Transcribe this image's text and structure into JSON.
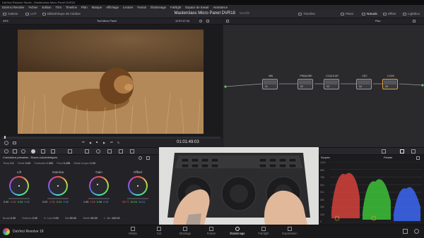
{
  "window": {
    "title": "DaVinci Resolve Studio - Masterclass Micro Panel DVR18"
  },
  "menu": [
    "DaVinci Resolve",
    "Fichier",
    "Edition",
    "Trim",
    "Timeline",
    "Plan",
    "Marque",
    "Affichage",
    "Lecture",
    "Fusion",
    "Étalonnage",
    "Fairlight",
    "Espace de travail",
    "Assistance"
  ],
  "toolbar": {
    "gallery": "Galerie",
    "lut": "LUT",
    "media_library": "Bibliothèque de médias",
    "project_title": "Masterclass Micro Panel DVR18",
    "modified": "Modifié",
    "timeline": "Timeline",
    "clips": "Plans",
    "nodes": "Nœuds",
    "effects": "Effets",
    "lightbox": "Lightbox"
  },
  "viewer": {
    "zoom": "44%",
    "clip_name": "Test Micro Panel",
    "timecode": "12:57:47:15",
    "playhead_timecode": "01:01:49:03"
  },
  "node_editor": {
    "mode": "Plan",
    "nodes": [
      {
        "label": "WB",
        "num": "01"
      },
      {
        "label": "PRIMAIRE",
        "num": "02"
      },
      {
        "label": "COULEUR",
        "num": "03"
      },
      {
        "label": "CEC",
        "num": "04"
      },
      {
        "label": "LOOK",
        "num": "05"
      }
    ]
  },
  "color_panel": {
    "title": "Corrections primaires - Roues colorimétriques",
    "params_top": [
      {
        "label": "Temp",
        "value": "0.0"
      },
      {
        "label": "Teinte",
        "value": "0.00"
      },
      {
        "label": "Contraste",
        "value": "1.000"
      },
      {
        "label": "Pivot",
        "value": "0.435"
      },
      {
        "label": "Détail moyen",
        "value": "0.00"
      }
    ],
    "wheels": [
      {
        "name": "Lift",
        "values": [
          "0.00",
          "-0.01",
          "0.00",
          "0.02"
        ]
      },
      {
        "name": "Gamma",
        "values": [
          "0.00",
          "-0.01",
          "0.01",
          "0.02"
        ]
      },
      {
        "name": "Gain",
        "values": [
          "1.05",
          "1.05",
          "0.98",
          "0.91"
        ]
      },
      {
        "name": "Offset",
        "values": [
          "25.77",
          "24.24",
          "24.21",
          ""
        ]
      }
    ],
    "params_bottom": [
      {
        "label": "Boost",
        "value": "0.00"
      },
      {
        "label": "Ombres",
        "value": "0.00"
      },
      {
        "label": "H. Lum",
        "value": "0.00"
      },
      {
        "label": "Sat",
        "value": "50.00"
      },
      {
        "label": "Teinte",
        "value": "50.00"
      },
      {
        "label": "L. Mix",
        "value": "100.00"
      }
    ]
  },
  "scopes": {
    "title": "Scopes",
    "mode": "Parade",
    "ticks": [
      "1023",
      "896",
      "768",
      "640",
      "512",
      "384",
      "256",
      "128",
      "0"
    ]
  },
  "pages": [
    "Média",
    "Cut",
    "Montage",
    "Fusion",
    "Étalonnage",
    "Fairlight",
    "Exportation"
  ],
  "app_name": "DaVinci Resolve 18"
}
